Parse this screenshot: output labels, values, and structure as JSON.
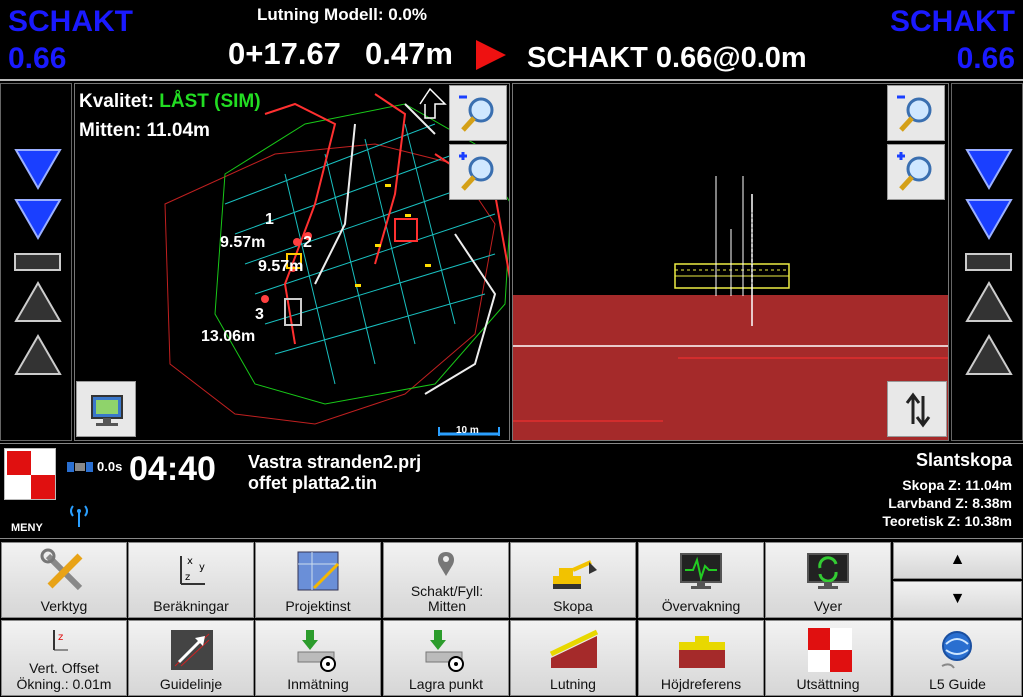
{
  "top": {
    "left_label": "SCHAKT",
    "left_value": "0.66",
    "right_label": "SCHAKT",
    "right_value": "0.66",
    "slope": "Lutning Modell: 0.0%",
    "station": "0+17.67",
    "offset": "0.47m",
    "cut_info": "SCHAKT 0.66@0.0m"
  },
  "plan": {
    "quality_label": "Kvalitet: ",
    "quality_value": "LÅST (SIM)",
    "center": "Mitten: 11.04m",
    "north": "N",
    "map_labels": [
      "1",
      "9.57m",
      "2",
      "9.57m",
      "3",
      "13.06m"
    ],
    "scale": "10 m"
  },
  "info": {
    "menu_label": "MENY",
    "sat_delay": "0.0s",
    "clock": "04:40",
    "project": "Vastra stranden2.prj",
    "surface": "offet platta2.tin",
    "bucket_name": "Slantskopa",
    "bucket_z": "Skopa Z: 11.04m",
    "track_z": "Larvband Z: 8.38m",
    "theoretical_z": "Teoretisk Z: 10.38m"
  },
  "menu": {
    "row1": [
      "Verktyg",
      "Beräkningar",
      "Projektinst",
      "Schakt/Fyll: Mitten",
      "Skopa",
      "Övervakning",
      "Vyer"
    ],
    "row2": [
      "Vert. Offset Ökning.: 0.01m",
      "Guidelinje",
      "Inmätning",
      "Lagra punkt",
      "Lutning",
      "Höjdreferens",
      "Utsättning",
      "L5 Guide"
    ],
    "up": "▲",
    "down": "▼"
  },
  "colors": {
    "schakt_blue": "#1a1aff",
    "quality_green": "#22dd22",
    "ground_red": "#a52a2a"
  }
}
